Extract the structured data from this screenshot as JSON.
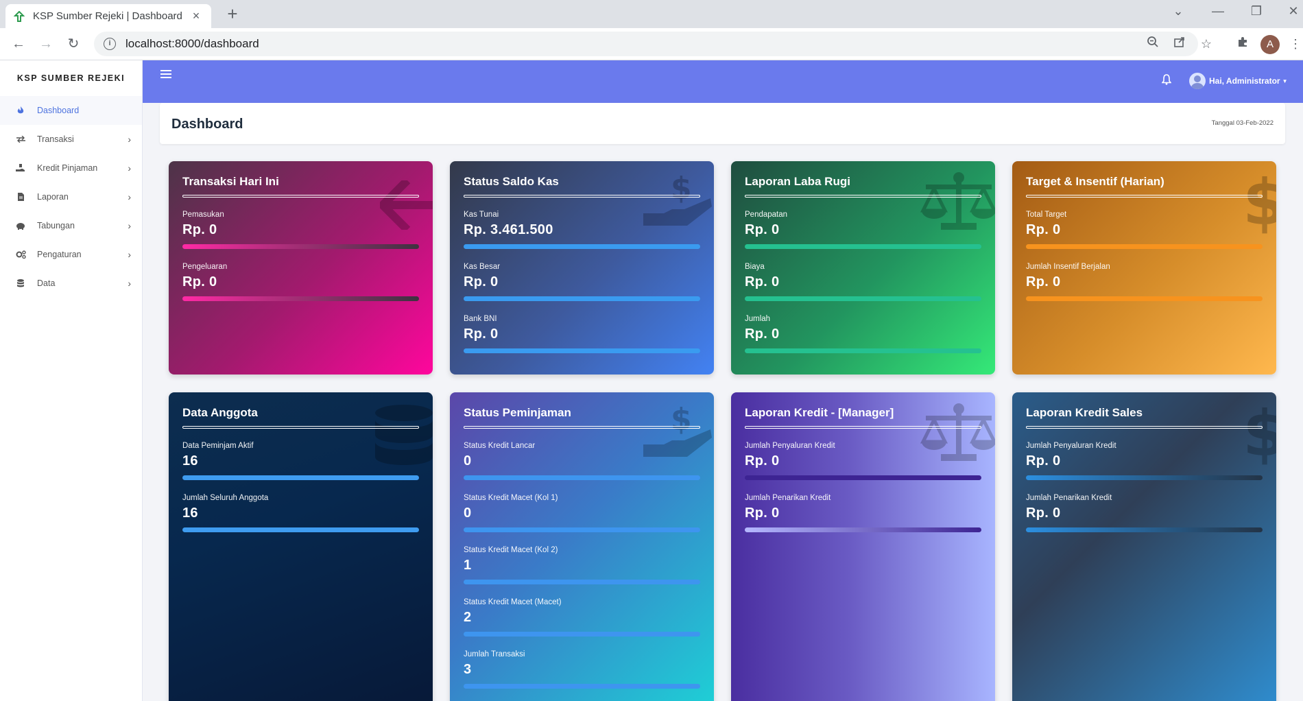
{
  "browser": {
    "tab_title": "KSP Sumber Rejeki | Dashboard",
    "tab_close": "×",
    "new_tab": "+",
    "url": "localhost:8000/dashboard"
  },
  "sidebar": {
    "brand": "KSP SUMBER REJEKI",
    "items": [
      {
        "label": "Dashboard",
        "icon": "fire-icon",
        "active": true
      },
      {
        "label": "Transaksi",
        "icon": "exchange-icon"
      },
      {
        "label": "Kredit Pinjaman",
        "icon": "hand-holding-icon"
      },
      {
        "label": "Laporan",
        "icon": "file-icon"
      },
      {
        "label": "Tabungan",
        "icon": "piggy-bank-icon"
      },
      {
        "label": "Pengaturan",
        "icon": "cogs-icon"
      },
      {
        "label": "Data",
        "icon": "database-icon"
      }
    ]
  },
  "topbar": {
    "user_label": "Hai, Administrator"
  },
  "page": {
    "title": "Dashboard",
    "date": "Tanggal 03-Feb-2022"
  },
  "cards": [
    {
      "title": "Transaksi Hari Ini",
      "stats": [
        {
          "label": "Pemasukan",
          "value": "Rp. 0"
        },
        {
          "label": "Pengeluaran",
          "value": "Rp. 0"
        }
      ]
    },
    {
      "title": "Status Saldo Kas",
      "stats": [
        {
          "label": "Kas Tunai",
          "value": "Rp. 3.461.500"
        },
        {
          "label": "Kas Besar",
          "value": "Rp. 0"
        },
        {
          "label": "Bank BNI",
          "value": "Rp. 0"
        }
      ]
    },
    {
      "title": "Laporan Laba Rugi",
      "stats": [
        {
          "label": "Pendapatan",
          "value": "Rp. 0"
        },
        {
          "label": "Biaya",
          "value": "Rp. 0"
        },
        {
          "label": "Jumlah",
          "value": "Rp. 0"
        }
      ]
    },
    {
      "title": "Target & Insentif (Harian)",
      "stats": [
        {
          "label": "Total Target",
          "value": "Rp. 0"
        },
        {
          "label": "Jumlah Insentif Berjalan",
          "value": "Rp. 0"
        }
      ]
    },
    {
      "title": "Data Anggota",
      "stats": [
        {
          "label": "Data Peminjam Aktif",
          "value": "16"
        },
        {
          "label": "Jumlah Seluruh Anggota",
          "value": "16"
        }
      ]
    },
    {
      "title": "Status Peminjaman",
      "stats": [
        {
          "label": "Status Kredit Lancar",
          "value": "0"
        },
        {
          "label": "Status Kredit Macet (Kol 1)",
          "value": "0"
        },
        {
          "label": "Status Kredit Macet (Kol 2)",
          "value": "1"
        },
        {
          "label": "Status Kredit Macet (Macet)",
          "value": "2"
        },
        {
          "label": "Jumlah Transaksi",
          "value": "3"
        }
      ]
    },
    {
      "title": "Laporan Kredit - [Manager]",
      "stats": [
        {
          "label": "Jumlah Penyaluran Kredit",
          "value": "Rp. 0"
        },
        {
          "label": "Jumlah Penarikan Kredit",
          "value": "Rp. 0"
        }
      ]
    },
    {
      "title": "Laporan Kredit Sales",
      "stats": [
        {
          "label": "Jumlah Penyaluran Kredit",
          "value": "Rp. 0"
        },
        {
          "label": "Jumlah Penarikan Kredit",
          "value": "Rp. 0"
        }
      ]
    }
  ],
  "colors": {
    "topbar": "#6a7aed",
    "sidebar_active": "#4e73df"
  }
}
